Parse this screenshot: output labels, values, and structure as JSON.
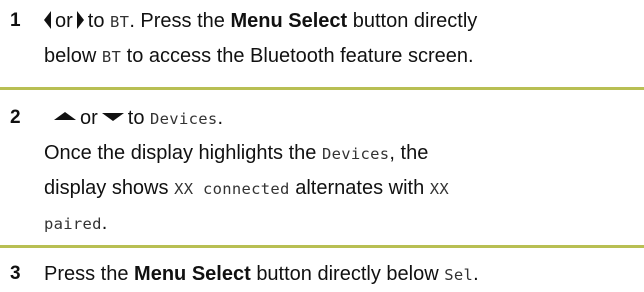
{
  "steps": [
    {
      "number": "1",
      "icon_a": "left-arrow-icon",
      "connector": "or",
      "icon_b": "right-arrow-icon",
      "text_to": "to",
      "target": "BT",
      "text_press": ". Press the",
      "button": "Menu Select",
      "text_below": "button directly below",
      "target_again": "BT",
      "text_access": "to access the Bluetooth feature screen."
    },
    {
      "number": "2",
      "icon_a": "up-arrow-icon",
      "connector": "or",
      "icon_b": "down-arrow-icon",
      "text_to": "to",
      "target": "Devices",
      "period": ".",
      "text_once": "Once the display highlights the",
      "target_again": "Devices",
      "text_comma": ", the",
      "text_display": "display shows",
      "status_a": "XX connected",
      "text_alternates": "alternates with",
      "status_b_1": "XX",
      "status_b_2": "paired",
      "period_end": "."
    },
    {
      "number": "3",
      "text_press": "Press the",
      "button": "Menu Select",
      "text_below": "button directly below",
      "target": "Sel",
      "period": "."
    }
  ],
  "colors": {
    "separator": "#b8bf53",
    "text": "#111111"
  }
}
